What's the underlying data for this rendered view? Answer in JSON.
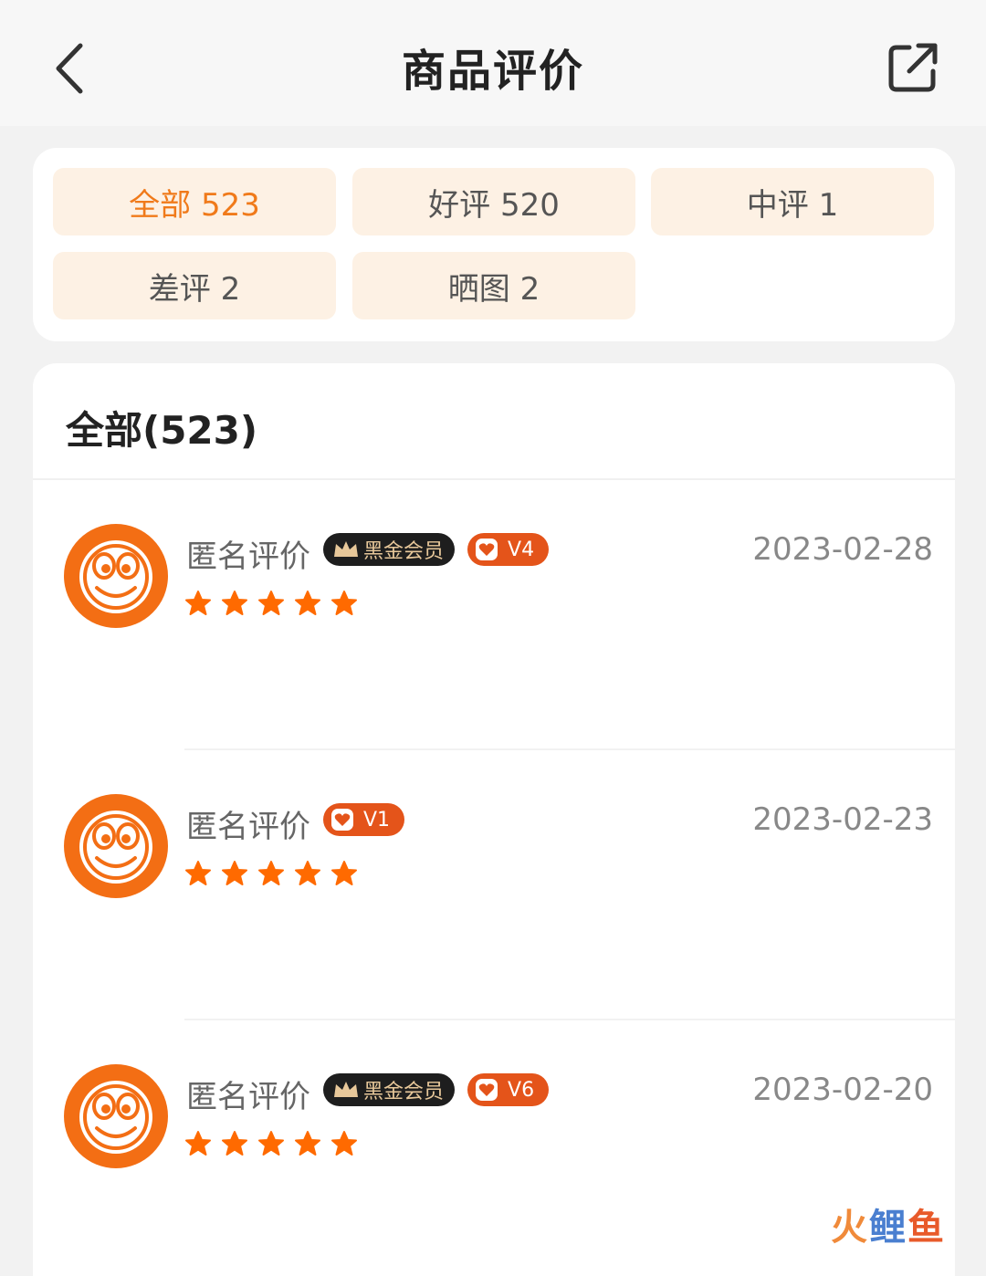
{
  "header": {
    "title": "商品评价"
  },
  "filters": [
    {
      "label": "全部 523",
      "active": true
    },
    {
      "label": "好评 520",
      "active": false
    },
    {
      "label": "中评 1",
      "active": false
    },
    {
      "label": "差评 2",
      "active": false
    },
    {
      "label": "晒图 2",
      "active": false
    }
  ],
  "list": {
    "title": "全部(523)",
    "reviews": [
      {
        "name": "匿名评价",
        "vip_label": "黑金会员",
        "level": "V4",
        "date": "2023-02-28",
        "rating": 5
      },
      {
        "name": "匿名评价",
        "vip_label": "",
        "level": "V1",
        "date": "2023-02-23",
        "rating": 5
      },
      {
        "name": "匿名评价",
        "vip_label": "黑金会员",
        "level": "V6",
        "date": "2023-02-20",
        "rating": 5
      }
    ]
  },
  "watermark": [
    "火",
    "鲤",
    "鱼"
  ],
  "colors": {
    "accent": "#f07a1a",
    "chip_bg": "#fdf1e4",
    "star": "#ff6a00",
    "level_badge": "#e4541a"
  }
}
